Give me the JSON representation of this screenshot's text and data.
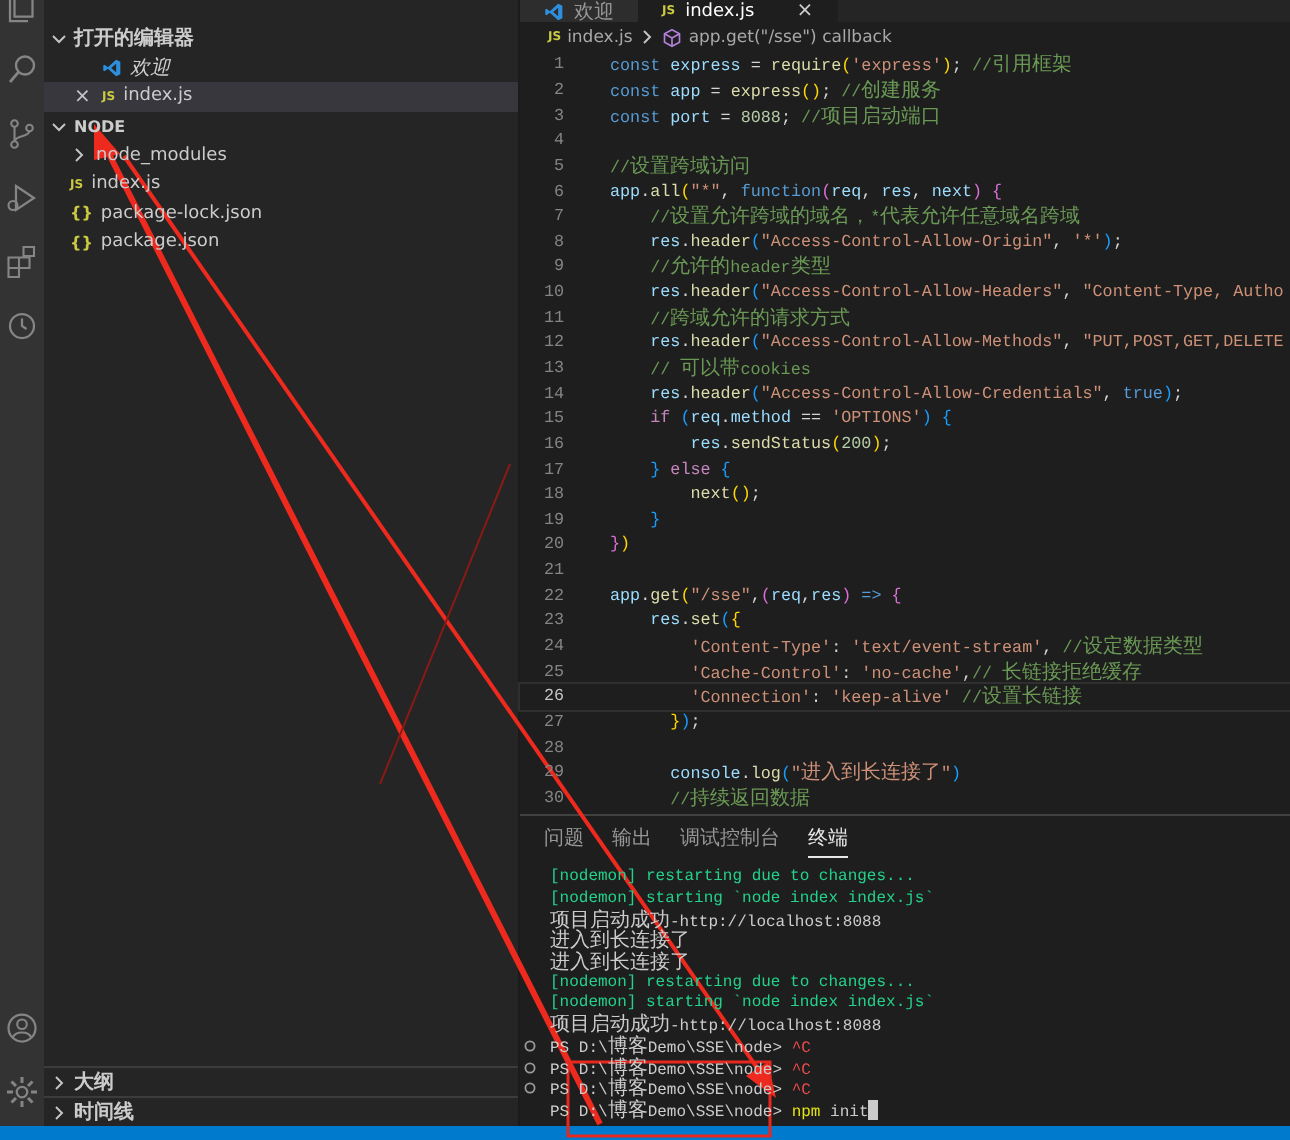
{
  "editor_tabs": [
    {
      "label": "欢迎",
      "kind": "welcome",
      "selected": false
    },
    {
      "label": "index.js",
      "kind": "js",
      "icon": "JS",
      "selected": true,
      "close": "×"
    }
  ],
  "sidebar": {
    "sections": [
      {
        "title": "打开的编辑器",
        "expanded": true,
        "items": [
          {
            "label": "欢迎",
            "kind": "welcome",
            "selected": false,
            "preview": true
          },
          {
            "label": "index.js",
            "kind": "file",
            "icon": "JS",
            "selected": true,
            "preview": false,
            "close": "×"
          }
        ]
      },
      {
        "title": "NODE",
        "expanded": true,
        "items": [
          {
            "label": "node_modules",
            "kind": "folder",
            "selected": false,
            "preview": false,
            "expanded": false
          },
          {
            "label": "index.js",
            "kind": "file",
            "icon": "JS",
            "selected": false,
            "preview": false
          },
          {
            "label": "package-lock.json",
            "kind": "file",
            "icon": "{}",
            "selected": false,
            "preview": false
          },
          {
            "label": "package.json",
            "kind": "file",
            "icon": "{}",
            "selected": false,
            "preview": false
          }
        ]
      }
    ],
    "bottom_sections": [
      {
        "title": "大纲",
        "expanded": false
      },
      {
        "title": "时间线",
        "expanded": false
      }
    ]
  },
  "breadcrumb": [
    {
      "label": "index.js",
      "kind": "file",
      "icon": "JS"
    },
    {
      "label": "app.get(\"/sse\") callback",
      "kind": "symbol"
    }
  ],
  "code": {
    "lines": [
      {
        "n": "1",
        "current": false,
        "tokens": [
          {
            "kind": "kw",
            "text": "const "
          },
          {
            "kind": "var",
            "text": "express"
          },
          {
            "kind": "p",
            "text": " = "
          },
          {
            "kind": "fn",
            "text": "require"
          },
          {
            "kind": "b1",
            "text": "("
          },
          {
            "kind": "str",
            "text": "'express'"
          },
          {
            "kind": "b1",
            "text": ")"
          },
          {
            "kind": "p",
            "text": "; "
          },
          {
            "kind": "cm",
            "text": "//引用框架"
          }
        ]
      },
      {
        "n": "2",
        "current": false,
        "tokens": [
          {
            "kind": "kw",
            "text": "const "
          },
          {
            "kind": "var",
            "text": "app"
          },
          {
            "kind": "p",
            "text": " = "
          },
          {
            "kind": "fn",
            "text": "express"
          },
          {
            "kind": "b1",
            "text": "()"
          },
          {
            "kind": "p",
            "text": "; "
          },
          {
            "kind": "cm",
            "text": "//创建服务"
          }
        ]
      },
      {
        "n": "3",
        "current": false,
        "tokens": [
          {
            "kind": "kw",
            "text": "const "
          },
          {
            "kind": "var",
            "text": "port"
          },
          {
            "kind": "p",
            "text": " = "
          },
          {
            "kind": "num",
            "text": "8088"
          },
          {
            "kind": "p",
            "text": "; "
          },
          {
            "kind": "cm",
            "text": "//项目启动端口"
          }
        ]
      },
      {
        "n": "4",
        "current": false
      },
      {
        "n": "5",
        "current": false,
        "tokens": [
          {
            "kind": "cm",
            "text": "//设置跨域访问"
          }
        ]
      },
      {
        "n": "6",
        "current": false,
        "tokens": [
          {
            "kind": "var",
            "text": "app"
          },
          {
            "kind": "p",
            "text": "."
          },
          {
            "kind": "fn",
            "text": "all"
          },
          {
            "kind": "b1",
            "text": "("
          },
          {
            "kind": "str",
            "text": "\"*\""
          },
          {
            "kind": "p",
            "text": ", "
          },
          {
            "kind": "kw",
            "text": "function"
          },
          {
            "kind": "b2",
            "text": "("
          },
          {
            "kind": "var",
            "text": "req"
          },
          {
            "kind": "p",
            "text": ", "
          },
          {
            "kind": "var",
            "text": "res"
          },
          {
            "kind": "p",
            "text": ", "
          },
          {
            "kind": "var",
            "text": "next"
          },
          {
            "kind": "b2",
            "text": ") {"
          }
        ]
      },
      {
        "n": "7",
        "current": false,
        "tokens": [
          {
            "kind": "cm",
            "text": "    //设置允许跨域的域名，*代表允许任意域名跨域"
          }
        ]
      },
      {
        "n": "8",
        "current": false,
        "tokens": [
          {
            "kind": "var",
            "text": "    res"
          },
          {
            "kind": "p",
            "text": "."
          },
          {
            "kind": "fn",
            "text": "header"
          },
          {
            "kind": "b3",
            "text": "("
          },
          {
            "kind": "str",
            "text": "\"Access-Control-Allow-Origin\""
          },
          {
            "kind": "p",
            "text": ", "
          },
          {
            "kind": "str",
            "text": "'*'"
          },
          {
            "kind": "b3",
            "text": ")"
          },
          {
            "kind": "p",
            "text": ";"
          }
        ]
      },
      {
        "n": "9",
        "current": false,
        "tokens": [
          {
            "kind": "cm",
            "text": "    //允许的header类型"
          }
        ]
      },
      {
        "n": "10",
        "current": false,
        "tokens": [
          {
            "kind": "var",
            "text": "    res"
          },
          {
            "kind": "p",
            "text": "."
          },
          {
            "kind": "fn",
            "text": "header"
          },
          {
            "kind": "b3",
            "text": "("
          },
          {
            "kind": "str",
            "text": "\"Access-Control-Allow-Headers\""
          },
          {
            "kind": "p",
            "text": ", "
          },
          {
            "kind": "str",
            "text": "\"Content-Type, Autho"
          }
        ]
      },
      {
        "n": "11",
        "current": false,
        "tokens": [
          {
            "kind": "cm",
            "text": "    //跨域允许的请求方式"
          }
        ]
      },
      {
        "n": "12",
        "current": false,
        "tokens": [
          {
            "kind": "var",
            "text": "    res"
          },
          {
            "kind": "p",
            "text": "."
          },
          {
            "kind": "fn",
            "text": "header"
          },
          {
            "kind": "b3",
            "text": "("
          },
          {
            "kind": "str",
            "text": "\"Access-Control-Allow-Methods\""
          },
          {
            "kind": "p",
            "text": ", "
          },
          {
            "kind": "str",
            "text": "\"PUT,POST,GET,DELETE"
          }
        ]
      },
      {
        "n": "13",
        "current": false,
        "tokens": [
          {
            "kind": "cm",
            "text": "    // 可以带cookies"
          }
        ]
      },
      {
        "n": "14",
        "current": false,
        "tokens": [
          {
            "kind": "var",
            "text": "    res"
          },
          {
            "kind": "p",
            "text": "."
          },
          {
            "kind": "fn",
            "text": "header"
          },
          {
            "kind": "b3",
            "text": "("
          },
          {
            "kind": "str",
            "text": "\"Access-Control-Allow-Credentials\""
          },
          {
            "kind": "p",
            "text": ", "
          },
          {
            "kind": "kw",
            "text": "true"
          },
          {
            "kind": "b3",
            "text": ")"
          },
          {
            "kind": "p",
            "text": ";"
          }
        ]
      },
      {
        "n": "15",
        "current": false,
        "tokens": [
          {
            "kind": "ctl",
            "text": "    if "
          },
          {
            "kind": "b3",
            "text": "("
          },
          {
            "kind": "var",
            "text": "req"
          },
          {
            "kind": "p",
            "text": "."
          },
          {
            "kind": "var",
            "text": "method"
          },
          {
            "kind": "p",
            "text": " == "
          },
          {
            "kind": "str",
            "text": "'OPTIONS'"
          },
          {
            "kind": "b3",
            "text": ") {"
          }
        ]
      },
      {
        "n": "16",
        "current": false,
        "tokens": [
          {
            "kind": "var",
            "text": "        res"
          },
          {
            "kind": "p",
            "text": "."
          },
          {
            "kind": "fn",
            "text": "sendStatus"
          },
          {
            "kind": "b1",
            "text": "("
          },
          {
            "kind": "num",
            "text": "200"
          },
          {
            "kind": "b1",
            "text": ")"
          },
          {
            "kind": "p",
            "text": ";"
          }
        ]
      },
      {
        "n": "17",
        "current": false,
        "tokens": [
          {
            "kind": "b3",
            "text": "    }"
          },
          {
            "kind": "ctl",
            "text": " else "
          },
          {
            "kind": "b3",
            "text": "{"
          }
        ]
      },
      {
        "n": "18",
        "current": false,
        "tokens": [
          {
            "kind": "fn",
            "text": "        next"
          },
          {
            "kind": "b1",
            "text": "()"
          },
          {
            "kind": "p",
            "text": ";"
          }
        ]
      },
      {
        "n": "19",
        "current": false,
        "tokens": [
          {
            "kind": "b3",
            "text": "    }"
          }
        ]
      },
      {
        "n": "20",
        "current": false,
        "tokens": [
          {
            "kind": "b2",
            "text": "}"
          },
          {
            "kind": "b1",
            "text": ")"
          }
        ]
      },
      {
        "n": "21",
        "current": false
      },
      {
        "n": "22",
        "current": false,
        "tokens": [
          {
            "kind": "var",
            "text": "app"
          },
          {
            "kind": "p",
            "text": "."
          },
          {
            "kind": "fn",
            "text": "get"
          },
          {
            "kind": "b1",
            "text": "("
          },
          {
            "kind": "str",
            "text": "\"/sse\""
          },
          {
            "kind": "p",
            "text": ","
          },
          {
            "kind": "b2",
            "text": "("
          },
          {
            "kind": "var",
            "text": "req"
          },
          {
            "kind": "p",
            "text": ","
          },
          {
            "kind": "var",
            "text": "res"
          },
          {
            "kind": "b2",
            "text": ")"
          },
          {
            "kind": "kw",
            "text": " => "
          },
          {
            "kind": "b2",
            "text": "{"
          }
        ]
      },
      {
        "n": "23",
        "current": false,
        "tokens": [
          {
            "kind": "var",
            "text": "    res"
          },
          {
            "kind": "p",
            "text": "."
          },
          {
            "kind": "fn",
            "text": "set"
          },
          {
            "kind": "b3",
            "text": "("
          },
          {
            "kind": "b1",
            "text": "{"
          }
        ]
      },
      {
        "n": "24",
        "current": false,
        "tokens": [
          {
            "kind": "str",
            "text": "        'Content-Type'"
          },
          {
            "kind": "p",
            "text": ": "
          },
          {
            "kind": "str",
            "text": "'text/event-stream'"
          },
          {
            "kind": "p",
            "text": ", "
          },
          {
            "kind": "cm",
            "text": "//设定数据类型"
          }
        ]
      },
      {
        "n": "25",
        "current": false,
        "tokens": [
          {
            "kind": "str",
            "text": "        'Cache-Control'"
          },
          {
            "kind": "p",
            "text": ": "
          },
          {
            "kind": "str",
            "text": "'no-cache'"
          },
          {
            "kind": "p",
            "text": ","
          },
          {
            "kind": "cm",
            "text": "// 长链接拒绝缓存"
          }
        ]
      },
      {
        "n": "26",
        "current": true,
        "tokens": [
          {
            "kind": "str",
            "text": "        'Connection'"
          },
          {
            "kind": "p",
            "text": ": "
          },
          {
            "kind": "str",
            "text": "'keep-alive'"
          },
          {
            "kind": "cm",
            "text": " //设置长链接"
          }
        ]
      },
      {
        "n": "27",
        "current": false,
        "tokens": [
          {
            "kind": "b1",
            "text": "      }"
          },
          {
            "kind": "b3",
            "text": ")"
          },
          {
            "kind": "p",
            "text": ";"
          }
        ]
      },
      {
        "n": "28",
        "current": false
      },
      {
        "n": "29",
        "current": false,
        "tokens": [
          {
            "kind": "var",
            "text": "      console"
          },
          {
            "kind": "p",
            "text": "."
          },
          {
            "kind": "fn",
            "text": "log"
          },
          {
            "kind": "b3",
            "text": "("
          },
          {
            "kind": "str",
            "text": "\"进入到长连接了\""
          },
          {
            "kind": "b3",
            "text": ")"
          }
        ]
      },
      {
        "n": "30",
        "current": false,
        "tokens": [
          {
            "kind": "cm",
            "text": "      //持续返回数据"
          }
        ]
      }
    ]
  },
  "panel": {
    "tabs": [
      {
        "label": "问题",
        "selected": false
      },
      {
        "label": "输出",
        "selected": false
      },
      {
        "label": "调试控制台",
        "selected": false
      },
      {
        "label": "终端",
        "selected": true
      }
    ],
    "terminal": [
      {
        "dot": false,
        "cursor": false,
        "tokens": [
          {
            "kind": "green",
            "text": "[nodemon] restarting due to changes..."
          }
        ]
      },
      {
        "dot": false,
        "cursor": false,
        "tokens": [
          {
            "kind": "green",
            "text": "[nodemon] starting `node index index.js`"
          }
        ]
      },
      {
        "dot": false,
        "cursor": false,
        "tokens": [
          {
            "kind": "plain",
            "text": "项目启动成功-http://localhost:8088"
          }
        ]
      },
      {
        "dot": false,
        "cursor": false,
        "tokens": [
          {
            "kind": "plain",
            "text": "进入到长连接了"
          }
        ]
      },
      {
        "dot": false,
        "cursor": false,
        "tokens": [
          {
            "kind": "plain",
            "text": "进入到长连接了"
          }
        ]
      },
      {
        "dot": false,
        "cursor": false,
        "tokens": [
          {
            "kind": "green",
            "text": "[nodemon] restarting due to changes..."
          }
        ]
      },
      {
        "dot": false,
        "cursor": false,
        "tokens": [
          {
            "kind": "green",
            "text": "[nodemon] starting `node index index.js`"
          }
        ]
      },
      {
        "dot": false,
        "cursor": false,
        "tokens": [
          {
            "kind": "plain",
            "text": "项目启动成功-http://localhost:8088"
          }
        ]
      },
      {
        "dot": true,
        "cursor": false,
        "tokens": [
          {
            "kind": "plain",
            "text": "PS D:\\博客Demo\\SSE\\node> "
          },
          {
            "kind": "red",
            "text": "^C"
          }
        ]
      },
      {
        "dot": true,
        "cursor": false,
        "tokens": [
          {
            "kind": "plain",
            "text": "PS D:\\博客Demo\\SSE\\node> "
          },
          {
            "kind": "red",
            "text": "^C"
          }
        ]
      },
      {
        "dot": true,
        "cursor": false,
        "tokens": [
          {
            "kind": "plain",
            "text": "PS D:\\博客Demo\\SSE\\node> "
          },
          {
            "kind": "red",
            "text": "^C"
          }
        ]
      },
      {
        "dot": false,
        "cursor": true,
        "tokens": [
          {
            "kind": "plain",
            "text": "PS D:\\博客Demo\\SSE\\node> "
          },
          {
            "kind": "yellow",
            "text": "npm"
          },
          {
            "kind": "plain",
            "text": " init"
          }
        ]
      }
    ]
  }
}
